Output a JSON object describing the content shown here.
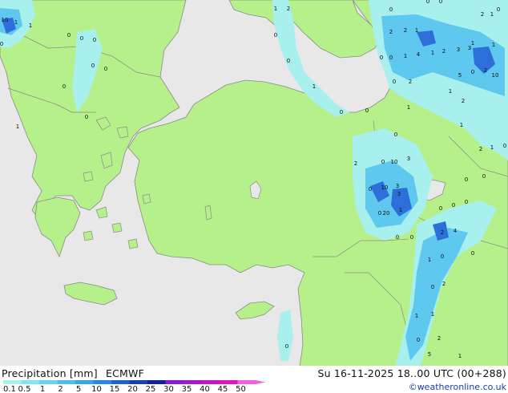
{
  "header": {
    "title": "Precipitation [mm]",
    "model": "ECMWF",
    "valid_time": "Su 16-11-2025 18..00 UTC (00+288)",
    "credit": "©weatheronline.co.uk"
  },
  "legend": {
    "labels": [
      "0.1",
      "0.5",
      "1",
      "2",
      "5",
      "10",
      "15",
      "20",
      "25",
      "30",
      "35",
      "40",
      "45",
      "50"
    ],
    "colors": [
      "#a8f0ee",
      "#86e4ee",
      "#6ad4ec",
      "#4cc0ea",
      "#38a6e6",
      "#2c88dc",
      "#1e66cc",
      "#1840b0",
      "#10249a",
      "#8a1ad8",
      "#a816cc",
      "#c614c0",
      "#e014c0",
      "#f060e0"
    ]
  },
  "colors": {
    "sea": "#e8e8e8",
    "land": "#b6f08a",
    "border": "#8a8a8a",
    "rain_light": "#a8f0ee",
    "rain_medium": "#5fc8ee",
    "rain_heavy": "#2c6fd8"
  },
  "map_labels": [
    "10",
    "1",
    "1",
    "0",
    "1",
    "2",
    "0",
    "0",
    "0",
    "0",
    "0",
    "0",
    "0",
    "0",
    "1",
    "0",
    "1",
    "0",
    "0",
    "0",
    "0",
    "0",
    "2",
    "1",
    "0",
    "2",
    "2",
    "1",
    "1",
    "0",
    "0",
    "1",
    "4",
    "1",
    "2",
    "3",
    "3",
    "1",
    "0",
    "2",
    "5",
    "0",
    "2",
    "10",
    "1",
    "2",
    "1",
    "1",
    "0",
    "2",
    "1",
    "0",
    "2",
    "0",
    "10",
    "3",
    "0",
    "10",
    "3",
    "3",
    "0",
    "20",
    "1",
    "0",
    "0",
    "0",
    "0",
    "0",
    "0",
    "0",
    "2",
    "4",
    "0",
    "1",
    "0",
    "0",
    "2",
    "1",
    "1",
    "2",
    "0",
    "5",
    "1",
    "0",
    "0"
  ]
}
